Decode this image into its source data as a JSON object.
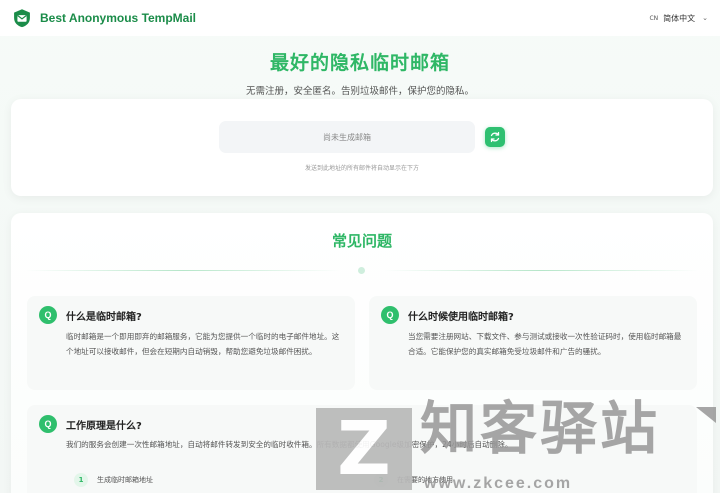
{
  "header": {
    "brand": "Best Anonymous TempMail",
    "language_code": "CN",
    "language_label": "简体中文"
  },
  "hero": {
    "title": "最好的隐私临时邮箱",
    "subtitle": "无需注册，安全匿名。告别垃圾邮件，保护您的隐私。"
  },
  "mailbox": {
    "placeholder": "尚未生成邮箱",
    "hint": "发送到此地址的所有邮件将自动显示在下方"
  },
  "faq": {
    "title": "常见问题",
    "items": [
      {
        "badge": "Q",
        "question": "什么是临时邮箱?",
        "answer": "临时邮箱是一个即用即弃的邮箱服务，它能为您提供一个临时的电子邮件地址。这个地址可以接收邮件，但会在短期内自动销毁，帮助您避免垃圾邮件困扰。"
      },
      {
        "badge": "Q",
        "question": "什么时候使用临时邮箱?",
        "answer": "当您需要注册网站、下载文件、参与测试或接收一次性验证码时，使用临时邮箱最合适。它能保护您的真实邮箱免受垃圾邮件和广告的骚扰。"
      },
      {
        "badge": "Q",
        "question": "工作原理是什么?",
        "answer": "我们的服务会创建一次性邮箱地址，自动将邮件转发到安全的临时收件箱。所有数据都使用Google级加密保护，24小时后自动删除。"
      }
    ],
    "steps": [
      {
        "num": "1",
        "label": "生成临时邮箱地址"
      },
      {
        "num": "2",
        "label": "在需要的地方使用"
      }
    ]
  },
  "watermark": {
    "text": "知客驿站",
    "url": "www.zkcee.com",
    "letter": "Z"
  },
  "colors": {
    "brand_green": "#1b8c49",
    "accent_green": "#2fb766",
    "button_green": "#2fc071"
  },
  "icons": {
    "logo": "mail-shield-icon",
    "refresh": "refresh-icon",
    "dropdown": "chevron-down-icon"
  }
}
